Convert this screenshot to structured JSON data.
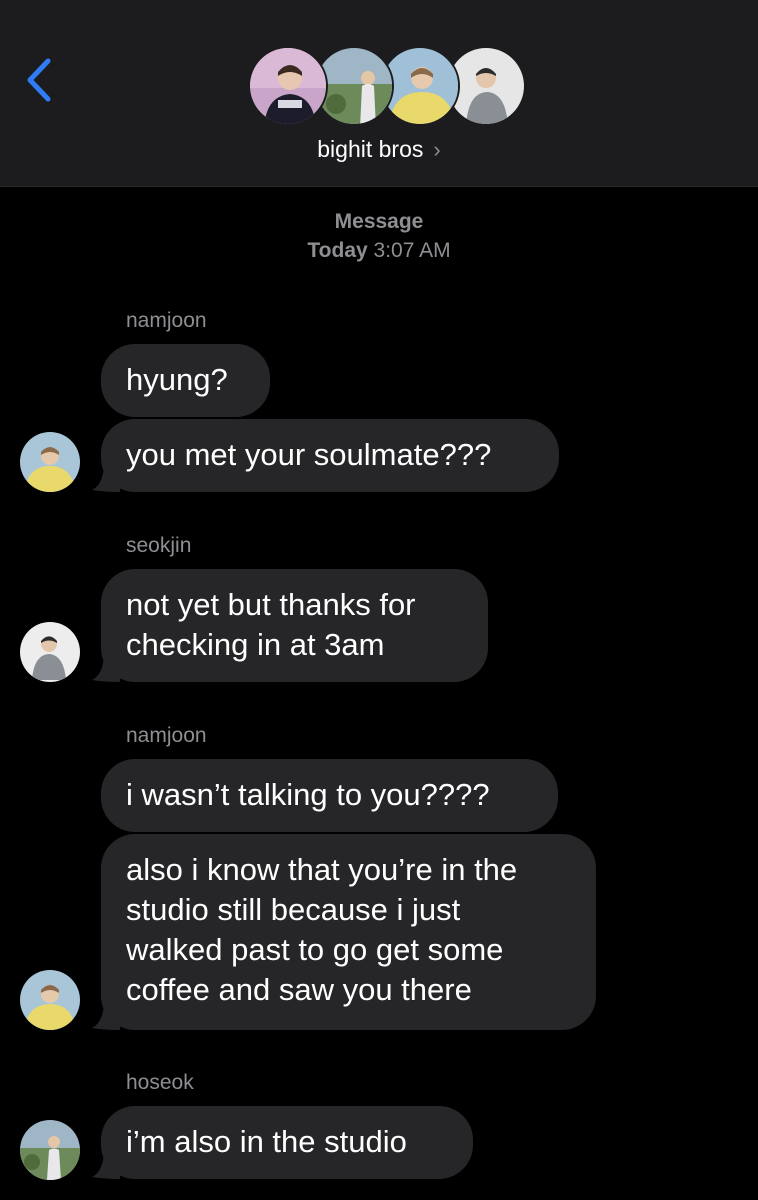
{
  "header": {
    "back_icon": "chevron-left-icon",
    "group_name": "bighit bros",
    "chevron": "›",
    "accent_color": "#2f7cf6"
  },
  "thread_meta": {
    "label": "Message",
    "day": "Today",
    "time": "3:07 AM"
  },
  "messages": [
    {
      "sender": "namjoon",
      "bubbles": [
        "hyung?",
        "you met your soulmate???"
      ]
    },
    {
      "sender": "seokjin",
      "bubbles": [
        "not yet but thanks for\nchecking in at 3am"
      ]
    },
    {
      "sender": "namjoon",
      "bubbles": [
        "i wasn’t talking to you????",
        "also i know that you’re in the\nstudio still because i just\nwalked past to go get some\ncoffee and saw you there"
      ]
    },
    {
      "sender": "hoseok",
      "bubbles": [
        "i’m also in the studio"
      ]
    }
  ],
  "colors": {
    "background": "#000000",
    "header_bg": "#1c1c1e",
    "bubble_bg": "#262629",
    "meta_text": "#8e8e93"
  }
}
